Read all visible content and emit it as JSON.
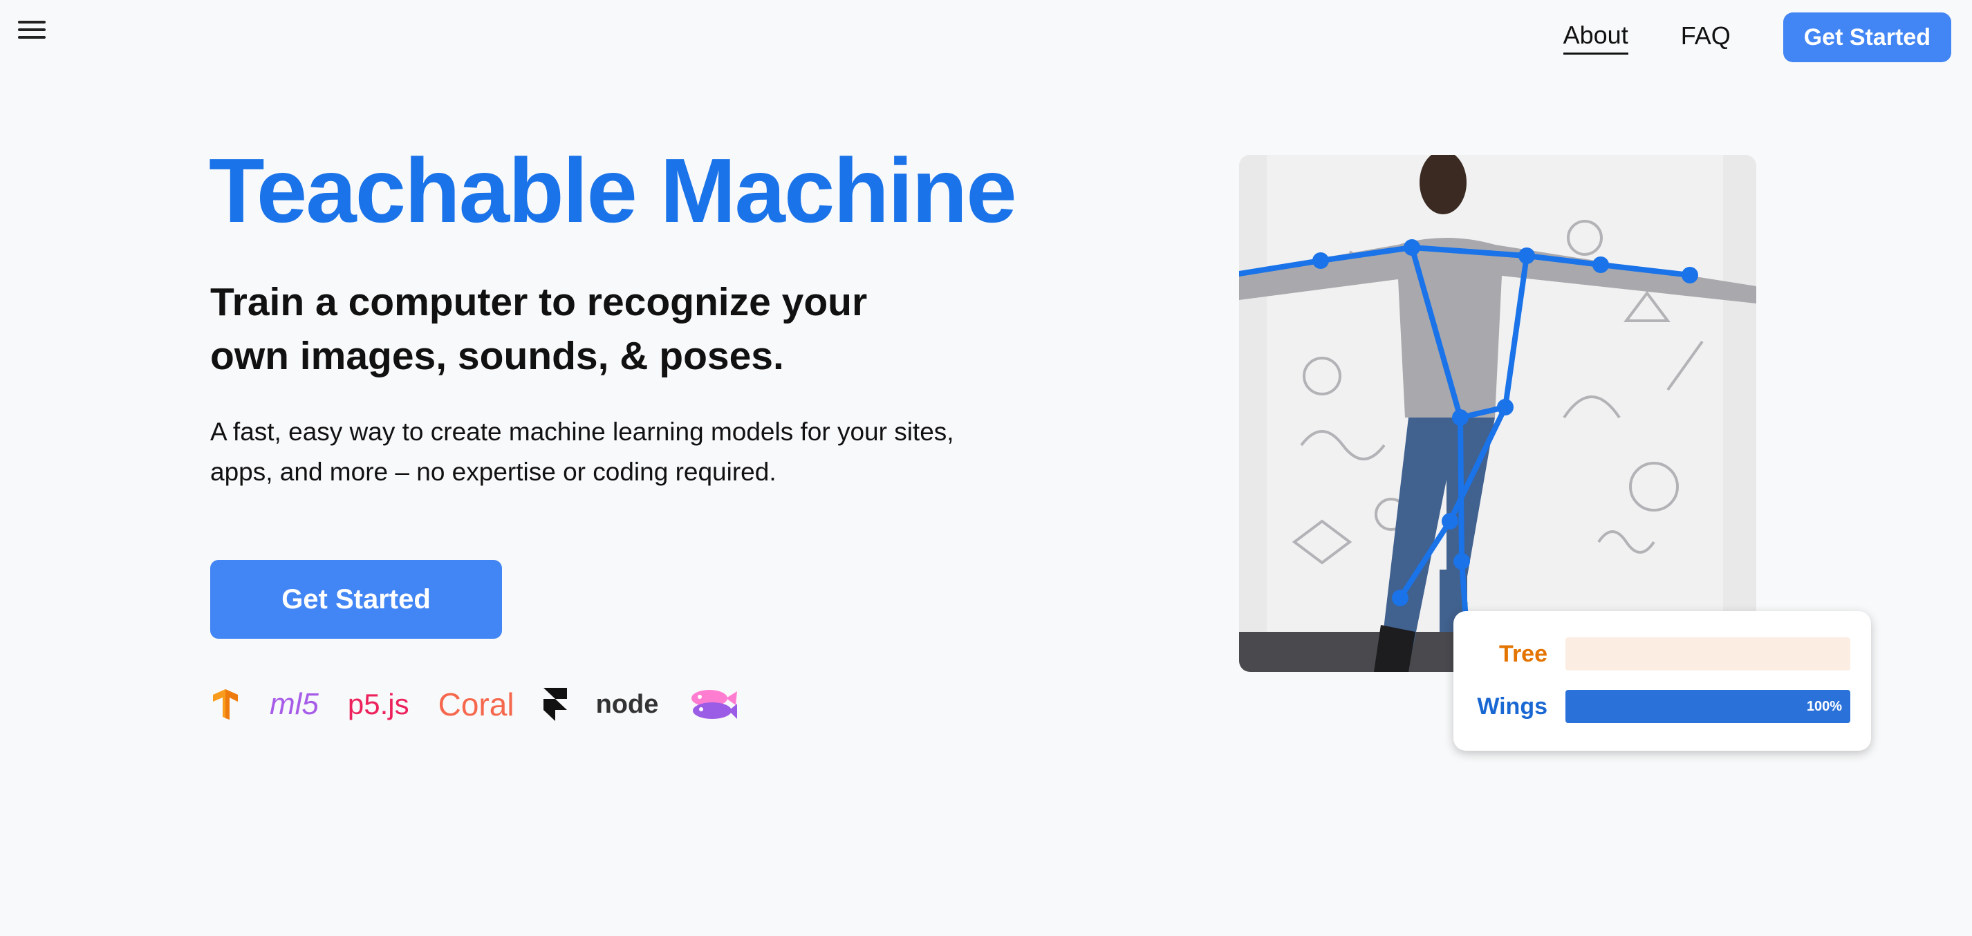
{
  "header": {
    "nav": [
      {
        "label": "About",
        "active": true
      },
      {
        "label": "FAQ",
        "active": false
      }
    ],
    "cta_label": "Get Started",
    "menu_icon": "hamburger-menu-icon"
  },
  "hero": {
    "title": "Teachable Machine",
    "subtitle": "Train a computer to recognize your own images, sounds, & poses.",
    "description": "A fast, easy way to create machine learning models for your sites, apps, and more – no expertise or coding required.",
    "cta_label": "Get Started",
    "logos": [
      {
        "name": "tensorflow-logo",
        "text": ""
      },
      {
        "name": "ml5-logo",
        "text": "ml5"
      },
      {
        "name": "p5js-logo",
        "text": "p5.js"
      },
      {
        "name": "coral-logo",
        "text": "Coral"
      },
      {
        "name": "framer-logo",
        "text": ""
      },
      {
        "name": "nodejs-logo",
        "text": "node"
      },
      {
        "name": "glitch-logo",
        "text": ""
      }
    ]
  },
  "demo": {
    "predictions": [
      {
        "label": "Tree",
        "value": 0,
        "color": "#e37400",
        "track_color": "#fbede2",
        "fill_color": "#e37400",
        "percent_text": ""
      },
      {
        "label": "Wings",
        "value": 1.0,
        "color": "#1967d2",
        "track_color": "#e8f0fe",
        "fill_color": "#2a72da",
        "percent_text": "100%"
      }
    ]
  },
  "colors": {
    "brand_blue": "#1a73e8",
    "button_blue": "#4285f4",
    "background": "#f8f9fa"
  }
}
